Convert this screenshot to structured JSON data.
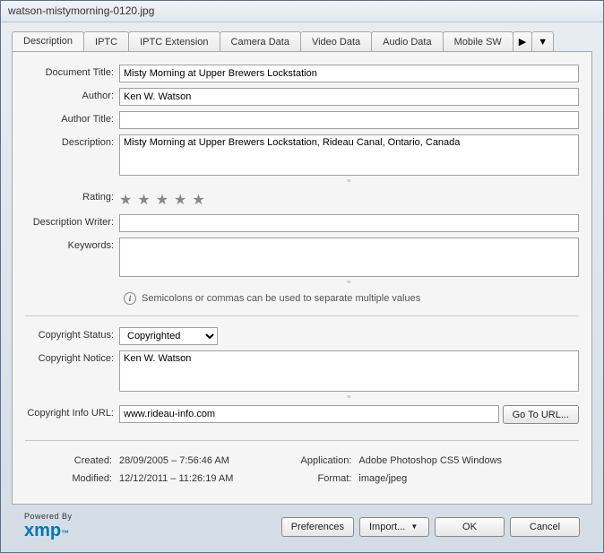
{
  "window": {
    "title": "watson-mistymorning-0120.jpg"
  },
  "tabs": {
    "items": [
      "Description",
      "IPTC",
      "IPTC Extension",
      "Camera Data",
      "Video Data",
      "Audio Data",
      "Mobile SW"
    ],
    "scroll_right": "▶",
    "overflow": "▼"
  },
  "labels": {
    "doc_title": "Document Title:",
    "author": "Author:",
    "author_title": "Author Title:",
    "description": "Description:",
    "rating": "Rating:",
    "desc_writer": "Description Writer:",
    "keywords": "Keywords:",
    "kw_hint": "Semicolons or commas can be used to separate multiple values",
    "copyright_status": "Copyright Status:",
    "copyright_notice": "Copyright Notice:",
    "copyright_url": "Copyright Info URL:",
    "go_url": "Go To URL...",
    "created": "Created:",
    "modified": "Modified:",
    "application": "Application:",
    "format": "Format:"
  },
  "values": {
    "doc_title": "Misty Morning at Upper Brewers Lockstation",
    "author": "Ken W. Watson",
    "author_title": "",
    "description": "Misty Morning at Upper Brewers Lockstation, Rideau Canal, Ontario, Canada",
    "desc_writer": "",
    "keywords": "",
    "copyright_status": "Copyrighted",
    "copyright_notice": "Ken W. Watson",
    "copyright_url": "www.rideau-info.com",
    "created": "28/09/2005 – 7:56:46 AM",
    "modified": "12/12/2011 – 11:26:19 AM",
    "application": "Adobe Photoshop CS5 Windows",
    "format": "image/jpeg"
  },
  "footer": {
    "powered": "Powered By",
    "logo": "xmp",
    "tm": "™",
    "preferences": "Preferences",
    "import": "Import...",
    "ok": "OK",
    "cancel": "Cancel"
  }
}
